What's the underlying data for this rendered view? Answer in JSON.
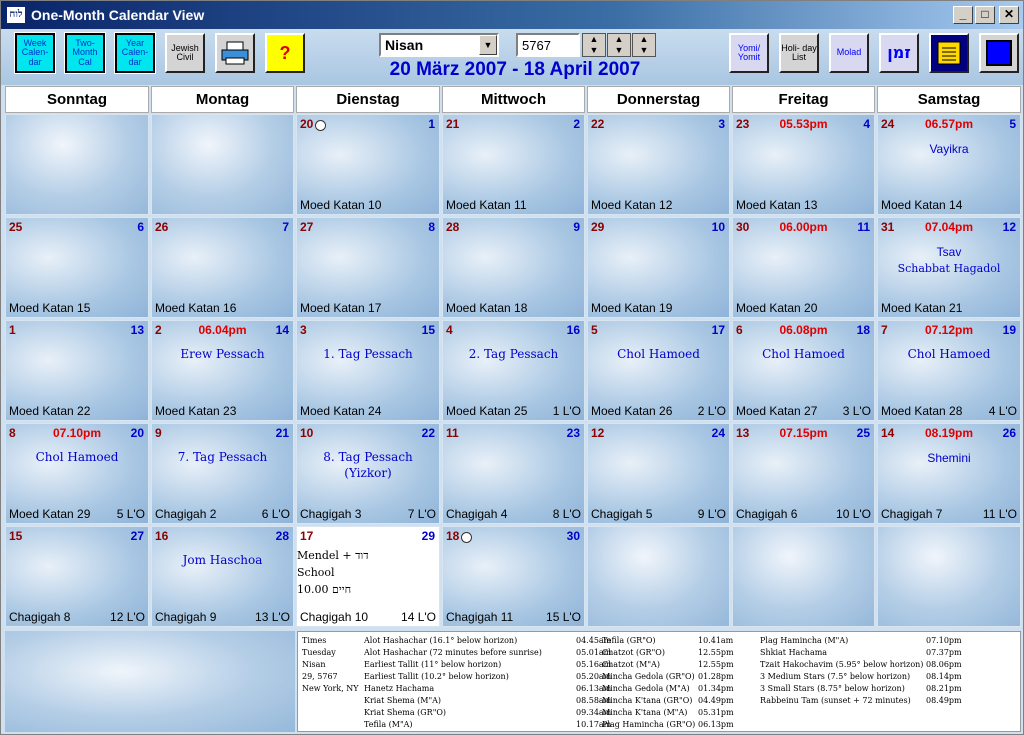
{
  "window": {
    "title": "One-Month Calendar View"
  },
  "toolbar": {
    "week_calendar": "Week Calen- dar",
    "two_month_cal": "Two- Month Cal",
    "year_calendar": "Year Calen- dar",
    "jewish_civil": "Jewish Civil",
    "help": "?",
    "month_select": "Nisan",
    "year_input": "5767",
    "yomi": "Yomi/ Yomit",
    "holiday_list": "Holi- day List",
    "molad": "Molad",
    "zman": "זמן"
  },
  "date_range": "20 März 2007 - 18 April 2007",
  "days_of_week": [
    "Sonntag",
    "Montag",
    "Dienstag",
    "Mittwoch",
    "Donnerstag",
    "Freitag",
    "Samstag"
  ],
  "weeks": [
    [
      {
        "blank": true
      },
      {
        "blank": true
      },
      {
        "civil": "20",
        "heb": "1",
        "moon": true,
        "bottom": "Moed Katan 10"
      },
      {
        "civil": "21",
        "heb": "2",
        "bottom": "Moed Katan 11"
      },
      {
        "civil": "22",
        "heb": "3",
        "bottom": "Moed Katan 12"
      },
      {
        "civil": "23",
        "heb": "4",
        "time": "05.53pm",
        "bottom": "Moed Katan 13"
      },
      {
        "civil": "24",
        "heb": "5",
        "time": "06.57pm",
        "parsha": "Vayikra",
        "bottom": "Moed Katan 14"
      }
    ],
    [
      {
        "civil": "25",
        "heb": "6",
        "bottom": "Moed Katan 15"
      },
      {
        "civil": "26",
        "heb": "7",
        "bottom": "Moed Katan 16"
      },
      {
        "civil": "27",
        "heb": "8",
        "bottom": "Moed Katan 17"
      },
      {
        "civil": "28",
        "heb": "9",
        "bottom": "Moed Katan 18"
      },
      {
        "civil": "29",
        "heb": "10",
        "bottom": "Moed Katan 19"
      },
      {
        "civil": "30",
        "heb": "11",
        "time": "06.00pm",
        "bottom": "Moed Katan 20"
      },
      {
        "civil": "31",
        "heb": "12",
        "time": "07.04pm",
        "parsha": "Tsav",
        "sub": "Schabbat Hagadol",
        "bottom": "Moed Katan 21"
      }
    ],
    [
      {
        "civil": "1",
        "heb": "13",
        "bottom": "Moed Katan 22"
      },
      {
        "civil": "2",
        "heb": "14",
        "time": "06.04pm",
        "event": "Erew Pessach",
        "bottom": "Moed Katan 23"
      },
      {
        "civil": "3",
        "heb": "15",
        "event": "1. Tag Pessach",
        "bottom": "Moed Katan 24"
      },
      {
        "civil": "4",
        "heb": "16",
        "event": "2. Tag Pessach",
        "bottom": "Moed Katan 25",
        "omer": "1 L'O"
      },
      {
        "civil": "5",
        "heb": "17",
        "event": "Chol Hamoed",
        "bottom": "Moed Katan 26",
        "omer": "2 L'O"
      },
      {
        "civil": "6",
        "heb": "18",
        "time": "06.08pm",
        "event": "Chol Hamoed",
        "bottom": "Moed Katan 27",
        "omer": "3 L'O"
      },
      {
        "civil": "7",
        "heb": "19",
        "time": "07.12pm",
        "event": "Chol Hamoed",
        "bottom": "Moed Katan 28",
        "omer": "4 L'O"
      }
    ],
    [
      {
        "civil": "8",
        "heb": "20",
        "time": "07.10pm",
        "event": "Chol Hamoed",
        "bottom": "Moed Katan 29",
        "omer": "5 L'O"
      },
      {
        "civil": "9",
        "heb": "21",
        "event": "7. Tag Pessach",
        "bottom": "Chagigah 2",
        "omer": "6 L'O"
      },
      {
        "civil": "10",
        "heb": "22",
        "event": "8. Tag Pessach",
        "event2": "(Yizkor)",
        "bottom": "Chagigah 3",
        "omer": "7 L'O"
      },
      {
        "civil": "11",
        "heb": "23",
        "bottom": "Chagigah 4",
        "omer": "8 L'O"
      },
      {
        "civil": "12",
        "heb": "24",
        "bottom": "Chagigah 5",
        "omer": "9 L'O"
      },
      {
        "civil": "13",
        "heb": "25",
        "time": "07.15pm",
        "bottom": "Chagigah 6",
        "omer": "10 L'O"
      },
      {
        "civil": "14",
        "heb": "26",
        "time": "08.19pm",
        "parsha": "Shemini",
        "bottom": "Chagigah 7",
        "omer": "11 L'O"
      }
    ],
    [
      {
        "civil": "15",
        "heb": "27",
        "bottom": "Chagigah 8",
        "omer": "12 L'O"
      },
      {
        "civil": "16",
        "heb": "28",
        "event": "Jom Haschoa",
        "bottom": "Chagigah 9",
        "omer": "13 L'O"
      },
      {
        "civil": "17",
        "heb": "29",
        "white": true,
        "notes": [
          "Mendel + דוד",
          "School",
          "10.00 חיים"
        ],
        "bottom": "Chagigah 10",
        "omer": "14 L'O"
      },
      {
        "civil": "18",
        "heb": "30",
        "moon": true,
        "bottom": "Chagigah 11",
        "omer": "15 L'O"
      },
      {
        "blank": true
      },
      {
        "blank": true
      },
      {
        "blank": true
      }
    ]
  ],
  "zmanim": {
    "location": [
      "Times",
      "Tuesday",
      "Nisan",
      "29, 5767",
      "New York, NY"
    ],
    "col1": [
      [
        "Alot Hashachar (16.1° below horizon)",
        "04.45am"
      ],
      [
        "Alot Hashachar (72 minutes before sunrise)",
        "05.01am"
      ],
      [
        "Earliest Tallit (11° below horizon)",
        "05.16am"
      ],
      [
        "Earliest Tallit (10.2° below horizon)",
        "05.20am"
      ],
      [
        "Hanetz Hachama",
        "06.13am"
      ],
      [
        "Kriat Shema (M\"A)",
        "08.58am"
      ],
      [
        "Kriat Shema (GR\"O)",
        "09.34am"
      ],
      [
        "Tefila (M\"A)",
        "10.17am"
      ]
    ],
    "col2": [
      [
        "Tefila (GR\"O)",
        "10.41am"
      ],
      [
        "Chatzot (GR\"O)",
        "12.55pm"
      ],
      [
        "Chatzot (M\"A)",
        "12.55pm"
      ],
      [
        "Mincha Gedola (GR\"O)",
        "01.28pm"
      ],
      [
        "Mincha Gedola (M\"A)",
        "01.34pm"
      ],
      [
        "Mincha K'tana (GR\"O)",
        "04.49pm"
      ],
      [
        "Mincha K'tana (M\"A)",
        "05.31pm"
      ],
      [
        "Plag Hamincha (GR\"O)",
        "06.13pm"
      ]
    ],
    "col3": [
      [
        "Plag Hamincha (M\"A)",
        "07.10pm"
      ],
      [
        "Shkiat Hachama",
        "07.37pm"
      ],
      [
        "Tzait Hakochavim (5.95° below horizon)",
        "08.06pm"
      ],
      [
        "3 Medium Stars (7.5° below horizon)",
        "08.14pm"
      ],
      [
        "3 Small Stars (8.75° below horizon)",
        "08.21pm"
      ],
      [
        "Rabbeinu Tam (sunset + 72 minutes)",
        "08.49pm"
      ]
    ]
  }
}
